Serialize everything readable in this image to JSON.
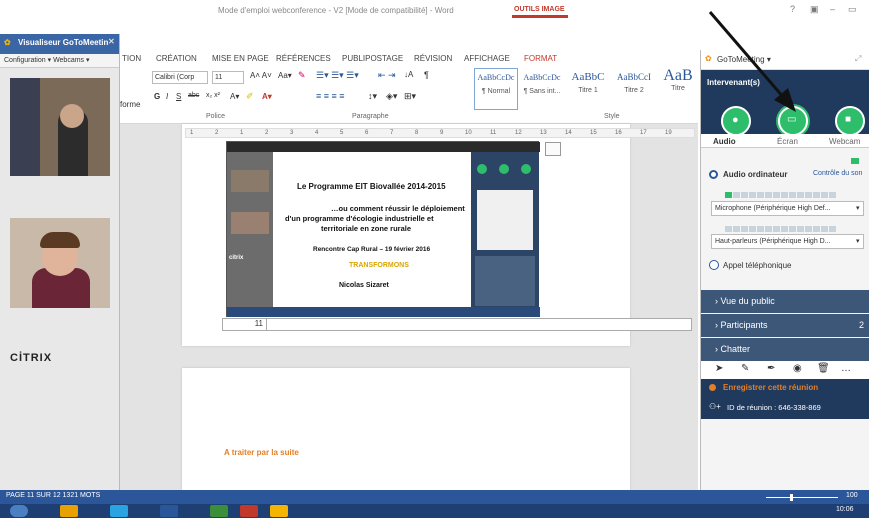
{
  "word": {
    "doc_title": "Mode d'emploi webconference - V2 [Mode de compatibilité] - Word",
    "tools_label": "OUTILS IMAGE",
    "tabs": [
      "TION",
      "CRÉATION",
      "MISE EN PAGE",
      "RÉFÉRENCES",
      "PUBLIPOSTAGE",
      "RÉVISION",
      "AFFICHAGE",
      "FORMAT"
    ],
    "left_cut": "forme",
    "font_name": "Calibri (Corp",
    "font_size": "11",
    "group_police": "Police",
    "group_paragraphe": "Paragraphe",
    "group_style": "Style",
    "styles": [
      {
        "sample": "AaBbCcDc",
        "name": "¶ Normal"
      },
      {
        "sample": "AaBbCcDc",
        "name": "¶ Sans int..."
      },
      {
        "sample": "AaBbC",
        "name": "Titre 1"
      },
      {
        "sample": "AaBbCcI",
        "name": "Titre 2"
      },
      {
        "sample": "AaB",
        "name": "Titre"
      }
    ],
    "ruler_marks": [
      "1",
      "2",
      "1",
      "2",
      "3",
      "4",
      "5",
      "6",
      "7",
      "8",
      "9",
      "10",
      "11",
      "12",
      "13",
      "14",
      "15",
      "16",
      "17",
      "19"
    ],
    "table_cell": "11",
    "footer_text": "A traiter par la suite",
    "status": "PAGE 11 SUR 12   1321 MOTS",
    "zoom": "100"
  },
  "slide": {
    "title": "Le Programme EIT Biovallée 2014-2015",
    "subtitle_l1": "…ou comment réussir le déploiement",
    "subtitle_l2": "d'un programme d'écologie industrielle et",
    "subtitle_l3": "territoriale en zone rurale",
    "event": "Rencontre Cap Rural – 19 février 2016",
    "logo": "TRANSFORMONS",
    "author": "Nicolas Sizaret",
    "citrix_small": "citrix"
  },
  "viewer": {
    "title": "Visualiseur GoToMeetin",
    "config": "Configuration",
    "webcams": "Webcams",
    "brand": "CİTRIX"
  },
  "panel": {
    "title": "GoToMeeting",
    "presenters": "Intervenant(s)",
    "tab_audio": "Audio",
    "tab_screen": "Écran",
    "tab_webcam": "Webcam",
    "audio_computer": "Audio ordinateur",
    "sound_check": "Contrôle du son",
    "microphone": "Microphone (Périphérique High Def...",
    "speakers": "Haut-parleurs (Périphérique High D...",
    "phone": "Appel téléphonique",
    "public_view": "Vue du public",
    "participants": "Participants",
    "participants_count": "2",
    "chat": "Chatter",
    "record": "Enregistrer cette réunion",
    "meeting_id": "ID de réunion : 646-338-869"
  },
  "taskbar": {
    "clock": "10:06"
  },
  "colors": {
    "word_blue": "#2b579a",
    "green": "#2ebd6b",
    "panel_dark": "#203a5e",
    "section": "#3d5778"
  }
}
